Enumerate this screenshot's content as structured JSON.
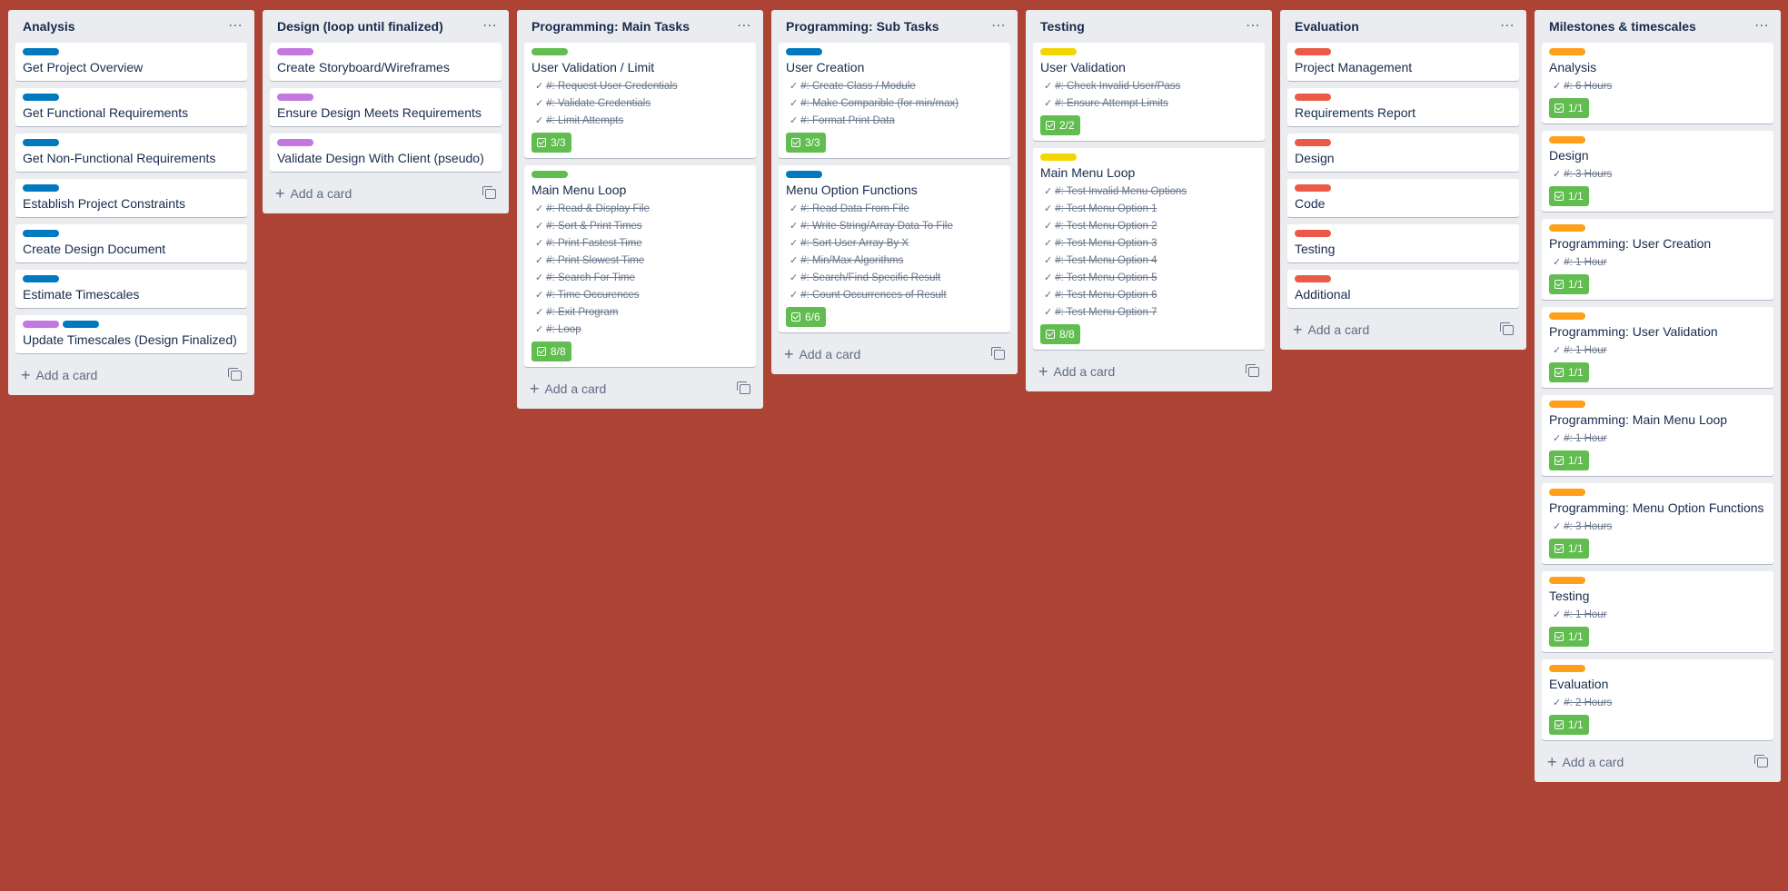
{
  "colors": {
    "board_bg": "#ac4335",
    "blue": "#0079bf",
    "purple": "#c377e0",
    "green": "#61bd4f",
    "yellow": "#f2d600",
    "red": "#eb5a46",
    "orange": "#ff9f1a"
  },
  "add_card_label": "Add a card",
  "lists": [
    {
      "title": "Analysis",
      "cards": [
        {
          "labels": [
            "blue"
          ],
          "title": "Get Project Overview",
          "items": []
        },
        {
          "labels": [
            "blue"
          ],
          "title": "Get Functional Requirements",
          "items": []
        },
        {
          "labels": [
            "blue"
          ],
          "title": "Get Non-Functional Requirements",
          "items": []
        },
        {
          "labels": [
            "blue"
          ],
          "title": "Establish Project Constraints",
          "items": []
        },
        {
          "labels": [
            "blue"
          ],
          "title": "Create Design Document",
          "items": []
        },
        {
          "labels": [
            "blue"
          ],
          "title": "Estimate Timescales",
          "items": []
        },
        {
          "labels": [
            "purple",
            "blue"
          ],
          "title": "Update Timescales (Design Finalized)",
          "items": []
        }
      ]
    },
    {
      "title": "Design (loop until finalized)",
      "cards": [
        {
          "labels": [
            "purple"
          ],
          "title": "Create Storyboard/Wireframes",
          "items": []
        },
        {
          "labels": [
            "purple"
          ],
          "title": "Ensure Design Meets Requirements",
          "items": []
        },
        {
          "labels": [
            "purple"
          ],
          "title": "Validate Design With Client (pseudo)",
          "items": []
        }
      ]
    },
    {
      "title": "Programming: Main Tasks",
      "cards": [
        {
          "labels": [
            "green"
          ],
          "title": "User Validation / Limit",
          "items": [
            "#: Request User Credentials",
            "#: Validate Credentials",
            "#: Limit Attempts"
          ],
          "badge": "3/3"
        },
        {
          "labels": [
            "green"
          ],
          "title": "Main Menu Loop",
          "items": [
            "#: Read & Display File",
            "#: Sort & Print Times",
            "#: Print Fastest Time",
            "#: Print Slowest Time",
            "#: Search For Time",
            "#: Time Occurences",
            "#: Exit Program",
            "#: Loop"
          ],
          "badge": "8/8"
        }
      ]
    },
    {
      "title": "Programming: Sub Tasks",
      "cards": [
        {
          "labels": [
            "blue"
          ],
          "title": "User Creation",
          "items": [
            "#: Create Class / Module",
            "#: Make Comparible (for min/max)",
            "#: Format Print Data"
          ],
          "badge": "3/3"
        },
        {
          "labels": [
            "blue"
          ],
          "title": "Menu Option Functions",
          "items": [
            "#: Read Data From File",
            "#: Write String/Array Data To File",
            "#: Sort User Array By X",
            "#: Min/Max Algorithms",
            "#: Search/Find Specific Result",
            "#: Count Occurrences of Result"
          ],
          "badge": "6/6"
        }
      ]
    },
    {
      "title": "Testing",
      "cards": [
        {
          "labels": [
            "yellow"
          ],
          "title": "User Validation",
          "items": [
            "#: Check Invalid User/Pass",
            "#: Ensure Attempt Limits"
          ],
          "badge": "2/2"
        },
        {
          "labels": [
            "yellow"
          ],
          "title": "Main Menu Loop",
          "items": [
            "#: Test Invalid Menu Options",
            "#: Test Menu Option 1",
            "#: Test Menu Option 2",
            "#: Test Menu Option 3",
            "#: Test Menu Option 4",
            "#: Test Menu Option 5",
            "#: Test Menu Option 6",
            "#: Test Menu Option 7"
          ],
          "badge": "8/8"
        }
      ]
    },
    {
      "title": "Evaluation",
      "cards": [
        {
          "labels": [
            "red"
          ],
          "title": "Project Management",
          "items": []
        },
        {
          "labels": [
            "red"
          ],
          "title": "Requirements Report",
          "items": []
        },
        {
          "labels": [
            "red"
          ],
          "title": "Design",
          "items": []
        },
        {
          "labels": [
            "red"
          ],
          "title": "Code",
          "items": []
        },
        {
          "labels": [
            "red"
          ],
          "title": "Testing",
          "items": []
        },
        {
          "labels": [
            "red"
          ],
          "title": "Additional",
          "items": []
        }
      ]
    },
    {
      "title": "Milestones & timescales",
      "cards": [
        {
          "labels": [
            "orange"
          ],
          "title": "Analysis",
          "items": [
            "#: 6 Hours"
          ],
          "badge": "1/1"
        },
        {
          "labels": [
            "orange"
          ],
          "title": "Design",
          "items": [
            "#: 3 Hours"
          ],
          "badge": "1/1"
        },
        {
          "labels": [
            "orange"
          ],
          "title": "Programming: User Creation",
          "items": [
            "#: 1 Hour"
          ],
          "badge": "1/1"
        },
        {
          "labels": [
            "orange"
          ],
          "title": "Programming: User Validation",
          "items": [
            "#: 1 Hour"
          ],
          "badge": "1/1"
        },
        {
          "labels": [
            "orange"
          ],
          "title": "Programming: Main Menu Loop",
          "items": [
            "#: 1 Hour"
          ],
          "badge": "1/1"
        },
        {
          "labels": [
            "orange"
          ],
          "title": "Programming: Menu Option Functions",
          "items": [
            "#: 3 Hours"
          ],
          "badge": "1/1"
        },
        {
          "labels": [
            "orange"
          ],
          "title": "Testing",
          "items": [
            "#: 1 Hour"
          ],
          "badge": "1/1"
        },
        {
          "labels": [
            "orange"
          ],
          "title": "Evaluation",
          "items": [
            "#: 2 Hours"
          ],
          "badge": "1/1"
        }
      ]
    }
  ]
}
